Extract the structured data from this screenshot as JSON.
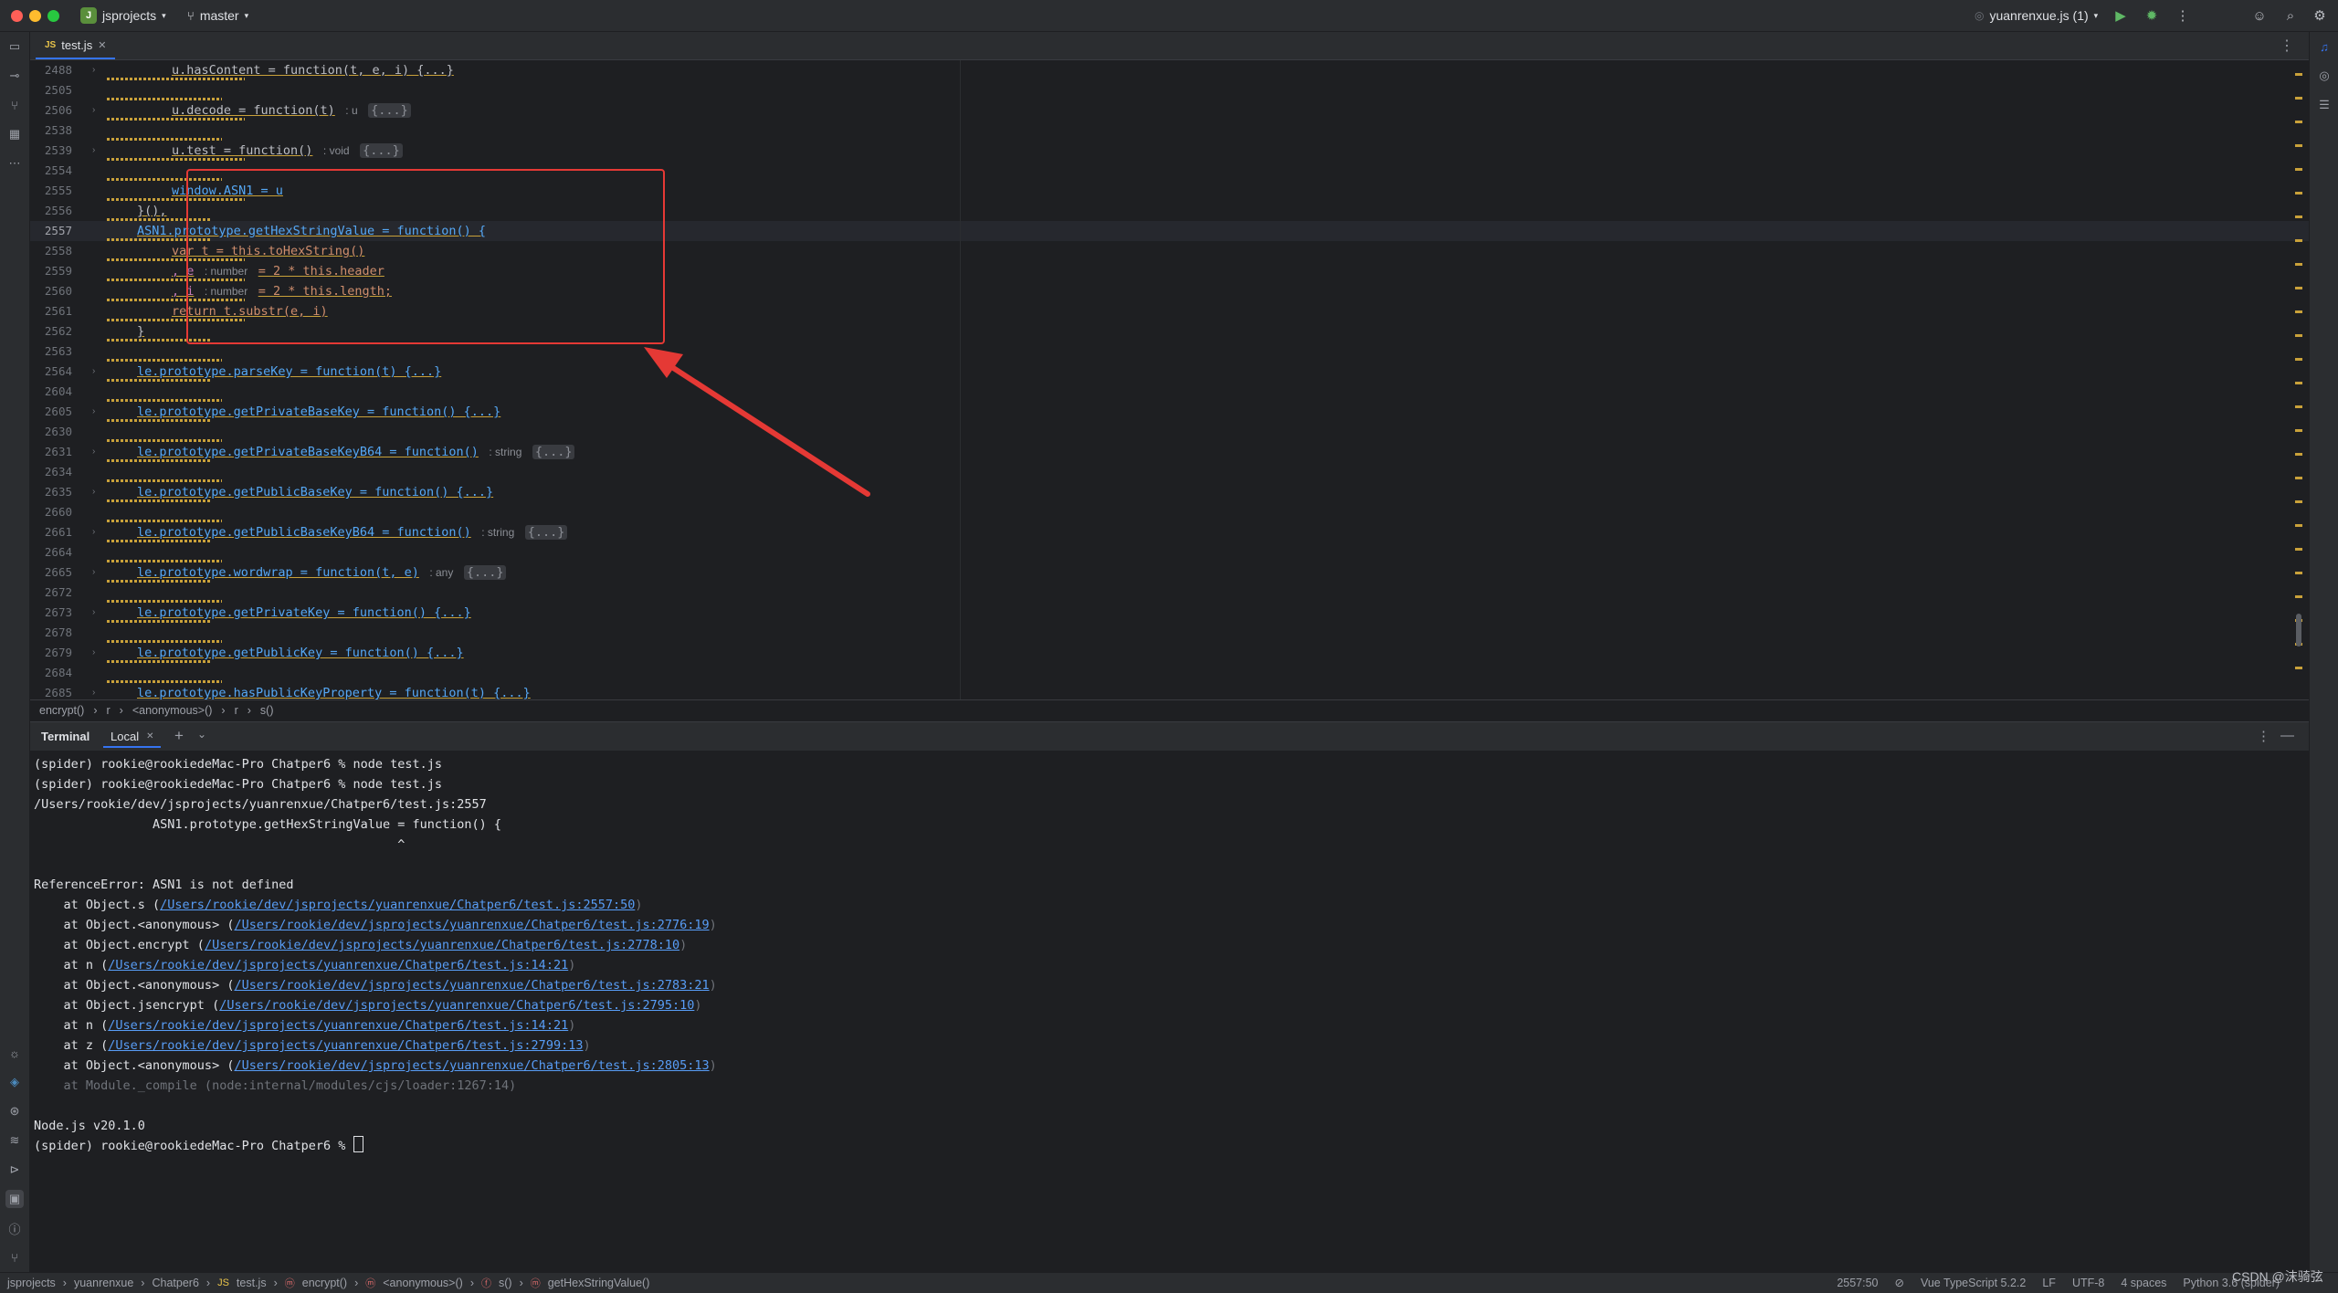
{
  "titlebar": {
    "project_badge": "J",
    "project": "jsprojects",
    "branch": "master",
    "run_config": "yuanrenxue.js (1)"
  },
  "tab": {
    "label": "test.js"
  },
  "editor": {
    "lines": [
      {
        "n": "2488",
        "fold": true,
        "code": "u.hasContent = function(t, e, i) {...}"
      },
      {
        "n": "2505",
        "fold": false,
        "code": ""
      },
      {
        "n": "2506",
        "fold": true,
        "code": "u.decode = function(t)",
        "hint": ": u",
        "tail": "{...}"
      },
      {
        "n": "2538",
        "fold": false,
        "code": ""
      },
      {
        "n": "2539",
        "fold": true,
        "code": "u.test = function()",
        "hint": ": void",
        "tail": "{...}"
      },
      {
        "n": "2554",
        "fold": false,
        "code": ""
      },
      {
        "n": "2555",
        "fold": false,
        "code": "window.ASN1 = u"
      },
      {
        "n": "2556",
        "fold": false,
        "code": "}(),"
      },
      {
        "n": "2557",
        "fold": false,
        "code": "ASN1.prototype.getHexStringValue = function() {"
      },
      {
        "n": "2558",
        "fold": false,
        "code": "var t = this.toHexString()"
      },
      {
        "n": "2559",
        "fold": false,
        "code": ", e",
        "hint": ": number",
        "tail": "= 2 * this.header"
      },
      {
        "n": "2560",
        "fold": false,
        "code": ", i",
        "hint": ": number",
        "tail": "= 2 * this.length;"
      },
      {
        "n": "2561",
        "fold": false,
        "code": "return t.substr(e, i)"
      },
      {
        "n": "2562",
        "fold": false,
        "code": "}"
      },
      {
        "n": "2563",
        "fold": false,
        "code": ""
      },
      {
        "n": "2564",
        "fold": true,
        "code": "le.prototype.parseKey = function(t) {...}"
      },
      {
        "n": "2604",
        "fold": false,
        "code": ""
      },
      {
        "n": "2605",
        "fold": true,
        "code": "le.prototype.getPrivateBaseKey = function() {...}"
      },
      {
        "n": "2630",
        "fold": false,
        "code": ""
      },
      {
        "n": "2631",
        "fold": true,
        "code": "le.prototype.getPrivateBaseKeyB64 = function()",
        "hint": ": string",
        "tail": "{...}"
      },
      {
        "n": "2634",
        "fold": false,
        "code": ""
      },
      {
        "n": "2635",
        "fold": true,
        "code": "le.prototype.getPublicBaseKey = function() {...}"
      },
      {
        "n": "2660",
        "fold": false,
        "code": ""
      },
      {
        "n": "2661",
        "fold": true,
        "code": "le.prototype.getPublicBaseKeyB64 = function()",
        "hint": ": string",
        "tail": "{...}"
      },
      {
        "n": "2664",
        "fold": false,
        "code": ""
      },
      {
        "n": "2665",
        "fold": true,
        "code": "le.prototype.wordwrap = function(t, e)",
        "hint": ": any",
        "tail": "{...}"
      },
      {
        "n": "2672",
        "fold": false,
        "code": ""
      },
      {
        "n": "2673",
        "fold": true,
        "code": "le.prototype.getPrivateKey = function() {...}"
      },
      {
        "n": "2678",
        "fold": false,
        "code": ""
      },
      {
        "n": "2679",
        "fold": true,
        "code": "le.prototype.getPublicKey = function() {...}"
      },
      {
        "n": "2684",
        "fold": false,
        "code": ""
      },
      {
        "n": "2685",
        "fold": true,
        "code": "le.prototype.hasPublicKeyProperty = function(t) {...}"
      }
    ]
  },
  "breadcrumbs": [
    "encrypt()",
    "r",
    "<anonymous>()",
    "r",
    "s()"
  ],
  "terminal": {
    "title": "Terminal",
    "tab": "Local",
    "lines": [
      {
        "pre": "(spider) rookie@rookiedeMac-Pro Chatper6 % node test.js"
      },
      {
        "pre": "(spider) rookie@rookiedeMac-Pro Chatper6 % node test.js"
      },
      {
        "pre": "/Users/rookie/dev/jsprojects/yuanrenxue/Chatper6/test.js:2557"
      },
      {
        "pre": "                ASN1.prototype.getHexStringValue = function() {"
      },
      {
        "pre": "                                                 ^"
      },
      {
        "pre": ""
      },
      {
        "pre": "ReferenceError: ASN1 is not defined"
      },
      {
        "pre": "    at Object.s (",
        "link": "/Users/rookie/dev/jsprojects/yuanrenxue/Chatper6/test.js:2557:50",
        "post": ")"
      },
      {
        "pre": "    at Object.<anonymous> (",
        "link": "/Users/rookie/dev/jsprojects/yuanrenxue/Chatper6/test.js:2776:19",
        "post": ")"
      },
      {
        "pre": "    at Object.encrypt (",
        "link": "/Users/rookie/dev/jsprojects/yuanrenxue/Chatper6/test.js:2778:10",
        "post": ")"
      },
      {
        "pre": "    at n (",
        "link": "/Users/rookie/dev/jsprojects/yuanrenxue/Chatper6/test.js:14:21",
        "post": ")"
      },
      {
        "pre": "    at Object.<anonymous> (",
        "link": "/Users/rookie/dev/jsprojects/yuanrenxue/Chatper6/test.js:2783:21",
        "post": ")"
      },
      {
        "pre": "    at Object.jsencrypt (",
        "link": "/Users/rookie/dev/jsprojects/yuanrenxue/Chatper6/test.js:2795:10",
        "post": ")"
      },
      {
        "pre": "    at n (",
        "link": "/Users/rookie/dev/jsprojects/yuanrenxue/Chatper6/test.js:14:21",
        "post": ")"
      },
      {
        "pre": "    at z (",
        "link": "/Users/rookie/dev/jsprojects/yuanrenxue/Chatper6/test.js:2799:13",
        "post": ")"
      },
      {
        "pre": "    at Object.<anonymous> (",
        "link": "/Users/rookie/dev/jsprojects/yuanrenxue/Chatper6/test.js:2805:13",
        "post": ")"
      },
      {
        "dim": "    at Module._compile (node:internal/modules/cjs/loader:1267:14)"
      },
      {
        "pre": ""
      },
      {
        "pre": "Node.js v20.1.0"
      },
      {
        "pre": "(spider) rookie@rookiedeMac-Pro Chatper6 % ",
        "cursor": true
      }
    ]
  },
  "statusbar": {
    "path": [
      "jsprojects",
      "yuanrenxue",
      "Chatper6",
      "test.js",
      "encrypt()",
      "<anonymous>()",
      "s()",
      "getHexStringValue()"
    ],
    "position": "2557:50",
    "language": "Vue TypeScript 5.2.2",
    "line_ending": "LF",
    "encoding": "UTF-8",
    "indent": "4 spaces",
    "interpreter": "Python 3.6 (spider)"
  },
  "watermark": "CSDN @沫骑弦",
  "colors": {
    "accent": "#3574f0",
    "annotation_red": "#e53935",
    "link": "#589df6",
    "warning_squiggle": "#c9a13a"
  }
}
